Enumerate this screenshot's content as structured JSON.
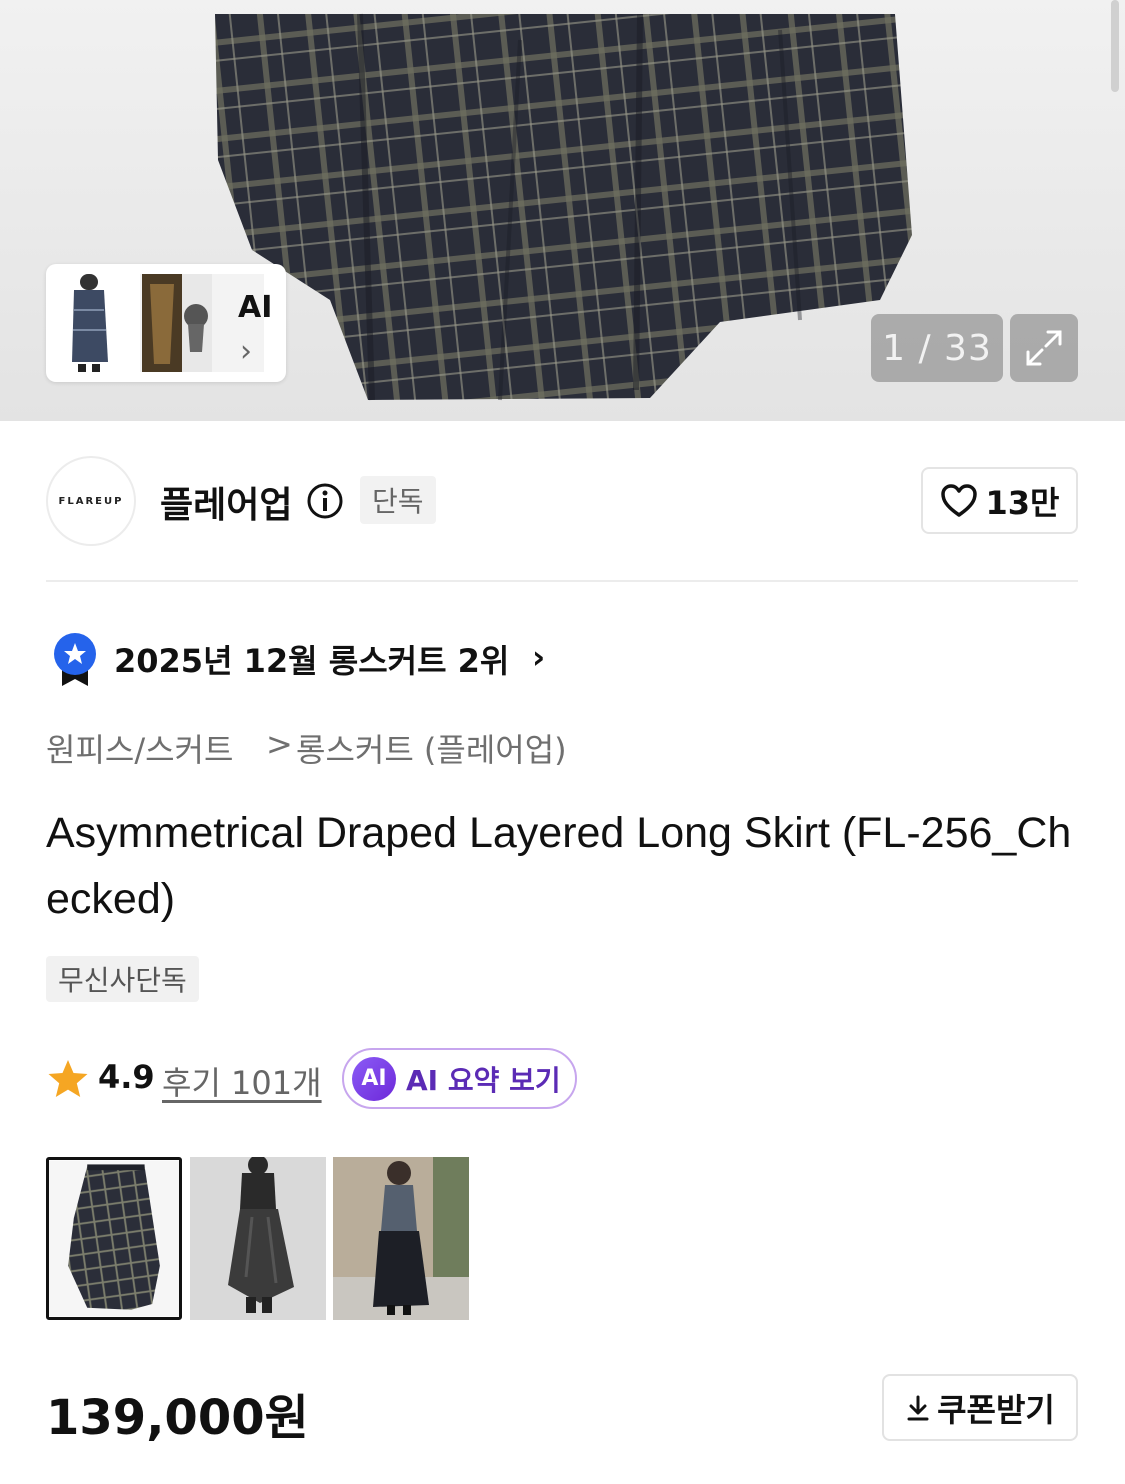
{
  "gallery": {
    "counter": "1 / 33",
    "ai_label": "AI",
    "ai_chevron": "›",
    "expand_icon": "expand-icon"
  },
  "brand": {
    "logo_text": "FLAREUP",
    "name": "플레어업",
    "info_icon": "info-icon",
    "badge": "단독",
    "likes": "13만",
    "like_icon": "heart-icon"
  },
  "ranking": {
    "text": "2025년 12월 롱스커트 2위",
    "chevron": "›",
    "icon": "ranking-medal-icon"
  },
  "breadcrumb": {
    "category": "원피스/스커트",
    "separator": ">",
    "subcategory": "롱스커트 (플레어업)"
  },
  "product": {
    "title": "Asymmetrical Draped Layered Long Skirt (FL-256_Checked)",
    "tag": "무신사단독",
    "rating": "4.9",
    "reviews": "후기 101개",
    "ai_summary_badge": "AI",
    "ai_summary_label": "AI 요약 보기",
    "price": "139,000원",
    "coupon_label": "쿠폰받기",
    "coupon_icon": "download-icon"
  },
  "colors": {
    "accent_purple": "#6d28d9",
    "star": "#f5a623",
    "medal_blue": "#2563eb"
  }
}
